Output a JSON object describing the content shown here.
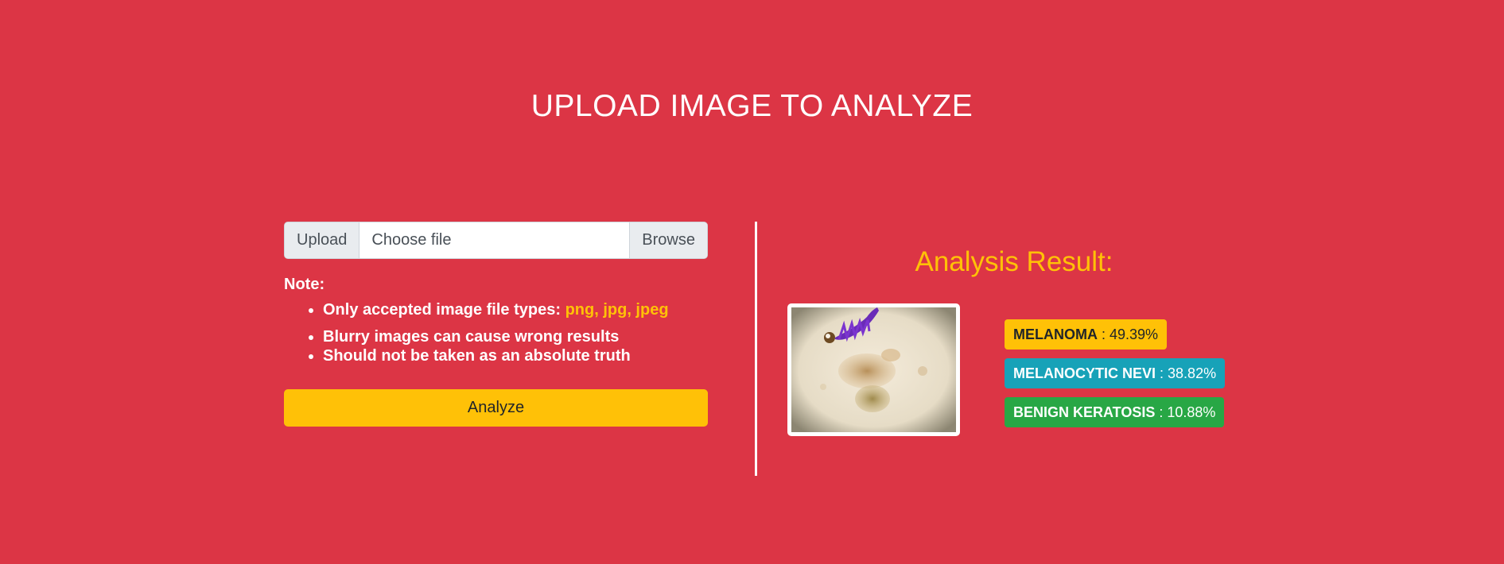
{
  "header": {
    "title": "UPLOAD IMAGE TO ANALYZE"
  },
  "upload": {
    "prefix": "Upload",
    "file_label": "Choose file",
    "browse_label": "Browse"
  },
  "note": {
    "heading": "Note:",
    "item1_text": "Only accepted image file types:",
    "item1_types": "png, jpg, jpeg",
    "item2": "Blurry images can cause wrong results",
    "item3": "Should not be taken as an absolute truth"
  },
  "analyze_button": "Analyze",
  "result": {
    "title": "Analysis Result:",
    "predictions": [
      {
        "label": "MELANOMA",
        "value": "49.39%",
        "color": "#ffc107"
      },
      {
        "label": "MELANOCYTIC NEVI",
        "value": "38.82%",
        "color": "#17a2b8"
      },
      {
        "label": "BENIGN KERATOSIS",
        "value": "10.88%",
        "color": "#28a745"
      }
    ],
    "separator": " : "
  },
  "colors": {
    "background": "#dc3545",
    "accent": "#ffc107"
  }
}
